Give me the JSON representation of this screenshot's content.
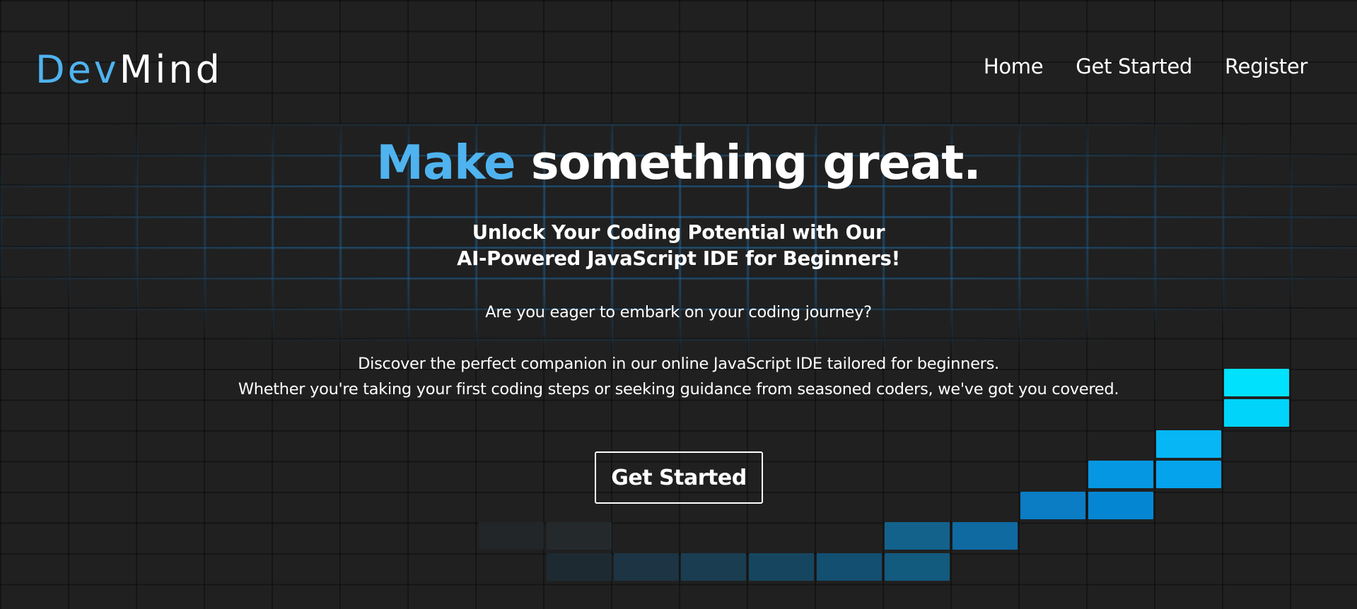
{
  "brand": {
    "part1": "Dev",
    "part2": "Mind",
    "accent_color": "#4fb3ef"
  },
  "nav": {
    "items": [
      {
        "label": "Home"
      },
      {
        "label": "Get Started"
      },
      {
        "label": "Register"
      }
    ]
  },
  "hero": {
    "headline_accent": "Make",
    "headline_rest": "something great.",
    "subhead_line1": "Unlock Your Coding Potential with Our",
    "subhead_line2": "AI-Powered JavaScript IDE for Beginners!",
    "question": "Are you eager to embark on your coding journey?",
    "body_line1": "Discover the perfect companion in our online JavaScript IDE tailored for beginners.",
    "body_line2": "Whether you're taking your first coding steps or seeking guidance from seasoned coders, we've got you covered.",
    "cta_label": "Get Started"
  },
  "colors": {
    "background": "#202020",
    "text": "#ffffff",
    "accent": "#4fb3ef"
  }
}
